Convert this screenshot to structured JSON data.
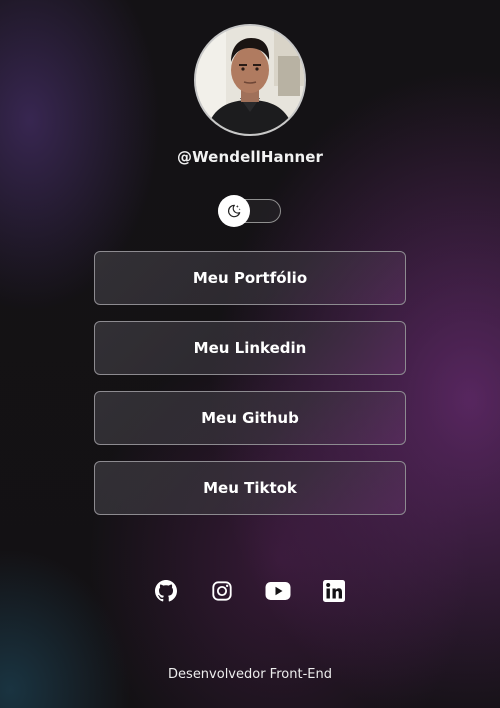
{
  "profile": {
    "handle": "@WendellHanner",
    "avatar_alt": "profile-photo"
  },
  "theme_toggle": {
    "icon": "moon-stars-icon",
    "state": "dark"
  },
  "links": [
    {
      "label": "Meu Portfólio"
    },
    {
      "label": "Meu Linkedin"
    },
    {
      "label": "Meu Github"
    },
    {
      "label": "Meu Tiktok"
    }
  ],
  "socials": [
    {
      "icon": "github-icon"
    },
    {
      "icon": "instagram-icon"
    },
    {
      "icon": "youtube-icon"
    },
    {
      "icon": "linkedin-icon"
    }
  ],
  "footer": {
    "text": "Desenvolvedor Front-End"
  },
  "colors": {
    "background": "#121113",
    "accent_purple": "#6e2d78",
    "button_border": "#8d8b90",
    "text": "#ffffff"
  }
}
